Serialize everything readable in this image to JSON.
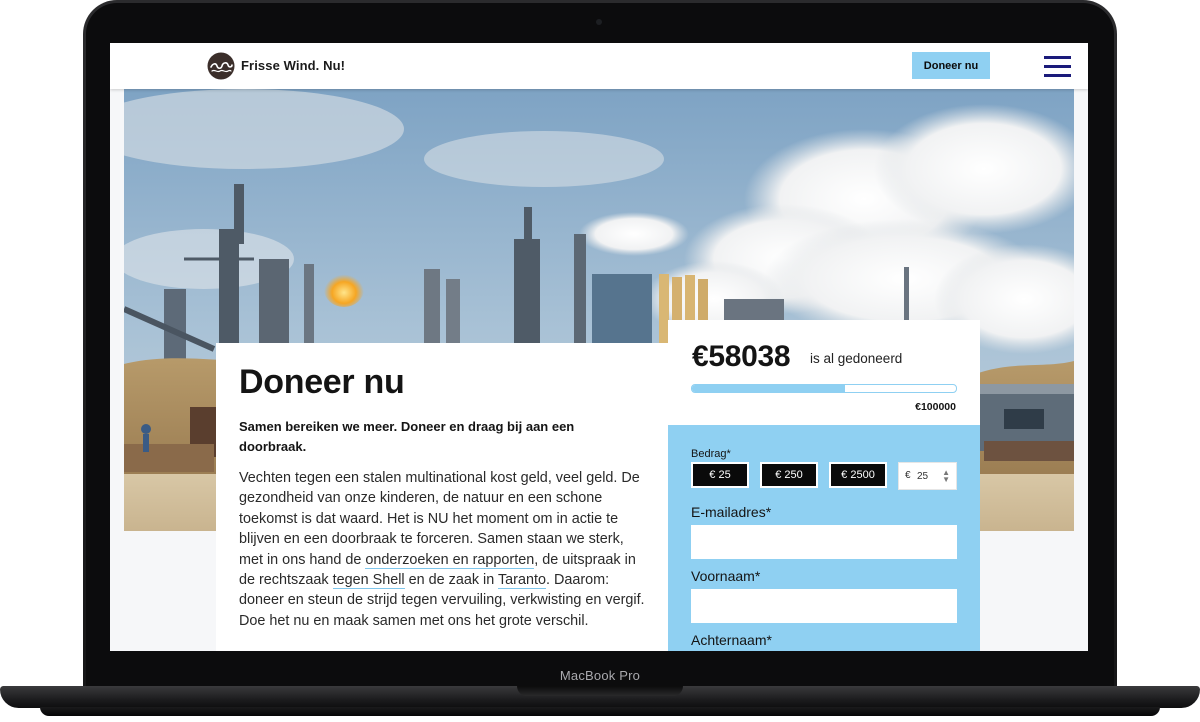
{
  "device": {
    "label": "MacBook Pro"
  },
  "header": {
    "logo_text": "Frisse Wind. Nu!",
    "donate_label": "Doneer nu",
    "menu_icon": "hamburger-menu-icon"
  },
  "content": {
    "title": "Doneer nu",
    "lead": "Samen bereiken we meer. Doneer en draag bij aan een doorbraak.",
    "body_part1": "Vechten tegen een stalen multinational kost geld, veel geld. De gezondheid van onze kinderen, de natuur en een schone toekomst is dat waard. Het is NU het moment om in actie te blijven en een doorbraak te forceren. Samen staan we sterk, met in ons hand de ",
    "link_reports": "onderzoeken en rapporten",
    "body_part2": ", de uitspraak in de rechtszaak ",
    "link_shell": "tegen Shell",
    "body_part3": " en de zaak in ",
    "link_taranto": "Taranto",
    "body_part4": ". Daarom: doneer en steun de strijd tegen vervuiling, verkwisting en vergif. Doe het nu en maak samen met ons het grote verschil."
  },
  "donation": {
    "total": "€58038",
    "total_label": "is al gedoneerd",
    "goal": "€100000",
    "progress_fraction": 0.58,
    "amount_label": "Bedrag*",
    "amounts": [
      "€ 25",
      "€ 250",
      "€ 2500"
    ],
    "custom_currency": "€",
    "custom_value": "25",
    "email_label": "E-mailadres*",
    "firstname_label": "Voornaam*",
    "lastname_label": "Achternaam*"
  },
  "colors": {
    "accent": "#8fd0f2",
    "menu": "#1a1a7a",
    "dark": "#0a0a0a"
  }
}
